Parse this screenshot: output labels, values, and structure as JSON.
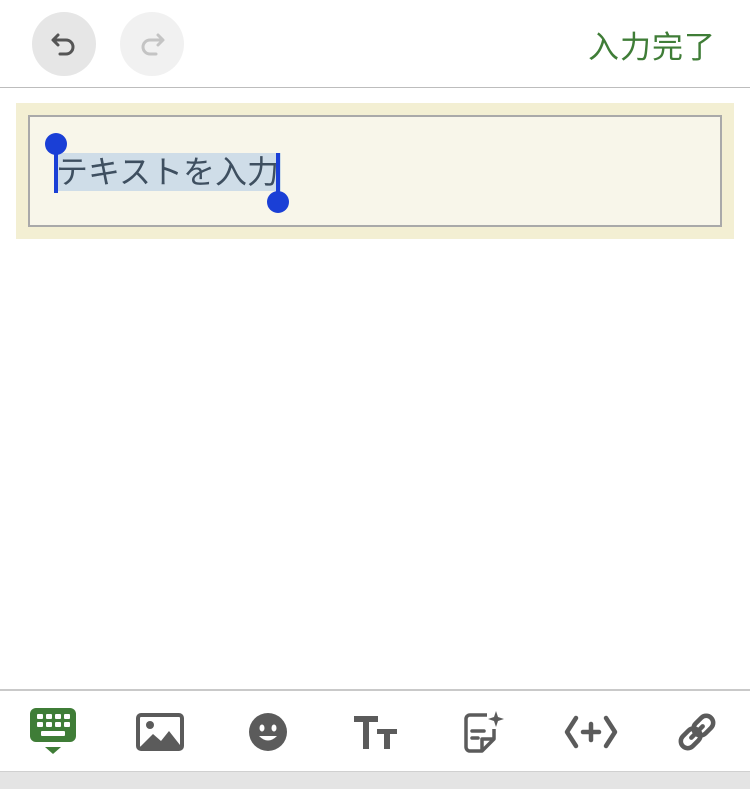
{
  "header": {
    "undo_icon": "undo-icon",
    "redo_icon": "redo-icon",
    "done_label": "入力完了"
  },
  "editor": {
    "selected_text": "テキストを入力"
  },
  "toolbar": {
    "tools": [
      {
        "name": "keyboard",
        "icon": "keyboard-icon",
        "active": true
      },
      {
        "name": "image",
        "icon": "image-icon",
        "active": false
      },
      {
        "name": "emoji",
        "icon": "emoji-icon",
        "active": false
      },
      {
        "name": "text-size",
        "icon": "text-size-icon",
        "active": false
      },
      {
        "name": "ai-document",
        "icon": "ai-document-icon",
        "active": false
      },
      {
        "name": "embed-code",
        "icon": "code-plus-icon",
        "active": false
      },
      {
        "name": "link",
        "icon": "link-icon",
        "active": false
      }
    ]
  },
  "colors": {
    "accent_green": "#3f7d37",
    "icon_gray": "#5b5b5b",
    "selection_handle": "#1a3fd6",
    "selection_bg": "#cfdde8",
    "block_bg": "#f3efd3"
  }
}
